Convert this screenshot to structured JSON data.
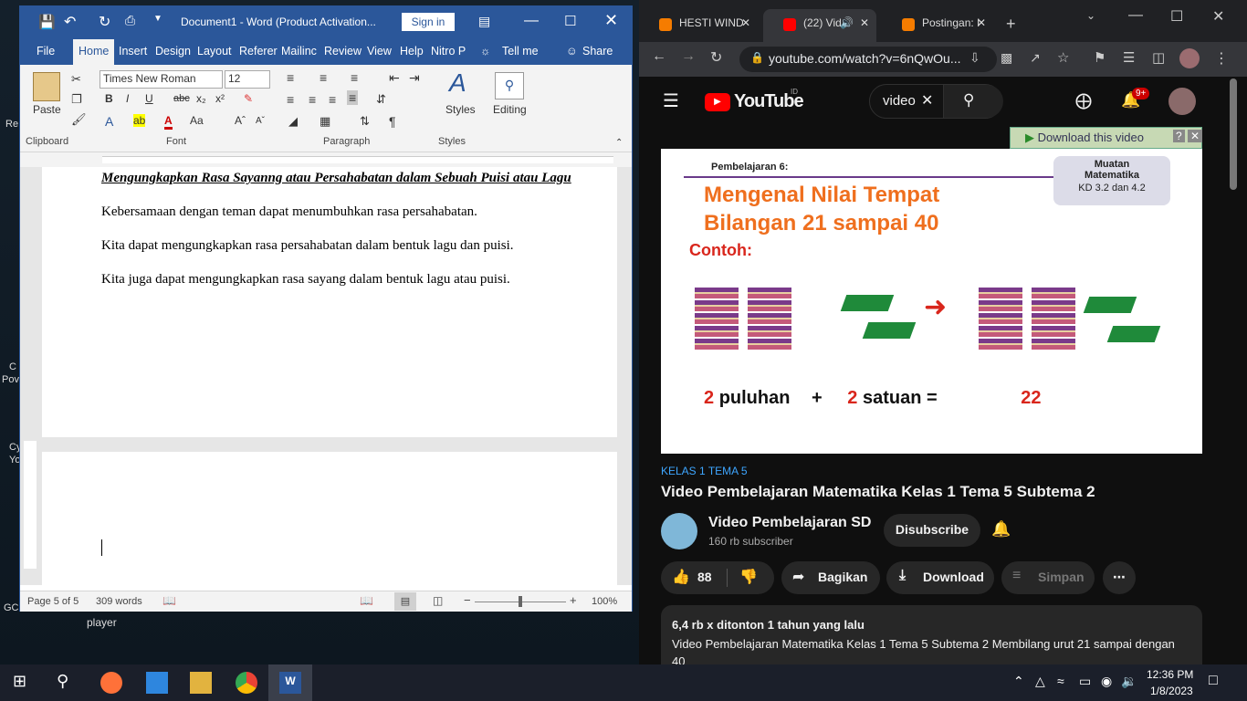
{
  "desktop": {
    "labels": [
      "Re",
      "C",
      "Pov",
      "Cy",
      "Yo",
      "GC",
      "player"
    ]
  },
  "word": {
    "title": "Document1 - Word (Product Activation...",
    "signin": "Sign in",
    "tabs": [
      "File",
      "Home",
      "Insert",
      "Design",
      "Layout",
      "Referer",
      "Mailinc",
      "Review",
      "View",
      "Help",
      "Nitro P"
    ],
    "tell_me": "Tell me",
    "share": "Share",
    "font_name": "Times New Roman",
    "font_size": "12",
    "paste": "Paste",
    "styles": "Styles",
    "editing": "Editing",
    "groups": [
      "Clipboard",
      "Font",
      "Paragraph",
      "Styles"
    ],
    "doc": {
      "heading": "Mengungkapkan Rasa Sayanng atau Persahabatan dalam Sebuah Puisi atau Lagu",
      "p1": "Kebersamaan dengan teman dapat menumbuhkan rasa persahabatan.",
      "p2": "Kita dapat mengungkapkan rasa persahabatan dalam bentuk lagu dan puisi.",
      "p3": "Kita juga dapat mengungkapkan rasa sayang dalam bentuk lagu atau puisi."
    },
    "status": {
      "page": "Page 5 of 5",
      "words": "309 words",
      "zoom": "100%"
    }
  },
  "chrome": {
    "tabs": [
      {
        "label": "HESTI WIND",
        "fav": "#f57c00"
      },
      {
        "label": "(22) Vid",
        "fav": "#ff0000"
      },
      {
        "label": "Postingan: I",
        "fav": "#f57c00"
      }
    ],
    "url": "youtube.com/watch?v=6nQwOu...",
    "search_value": "video",
    "notif_count": "9+",
    "youtube_logo": "YouTube",
    "youtube_region": "ID",
    "download_bar": "Download this video",
    "video": {
      "lesson": "Pembelajaran 6:",
      "badge_title": "Muatan Matematika",
      "badge_kd": "KD 3.2 dan 4.2",
      "title_line1": "Mengenal Nilai Tempat",
      "title_line2": "Bilangan 21 sampai 40",
      "contoh": "Contoh:",
      "eq_n1": "2",
      "eq_w1": "puluhan",
      "eq_plus": "+",
      "eq_n2": "2",
      "eq_w2": "satuan",
      "eq_equals": "=",
      "eq_result": "22"
    },
    "hashtag": "KELAS 1 TEMA 5",
    "video_title": "Video Pembelajaran Matematika Kelas 1 Tema 5 Subtema 2",
    "channel": "Video Pembelajaran SD",
    "subscribers": "160 rb subscriber",
    "subscribe": "Disubscribe",
    "likes": "88",
    "share": "Bagikan",
    "download": "Download",
    "save": "Simpan",
    "views": "6,4 rb x ditonton  1 tahun yang lalu",
    "description": "Video Pembelajaran Matematika Kelas 1 Tema 5 Subtema 2 Membilang urut 21 sampai dengan 40"
  },
  "taskbar": {
    "time": "12:36 PM",
    "date": "1/8/2023"
  }
}
